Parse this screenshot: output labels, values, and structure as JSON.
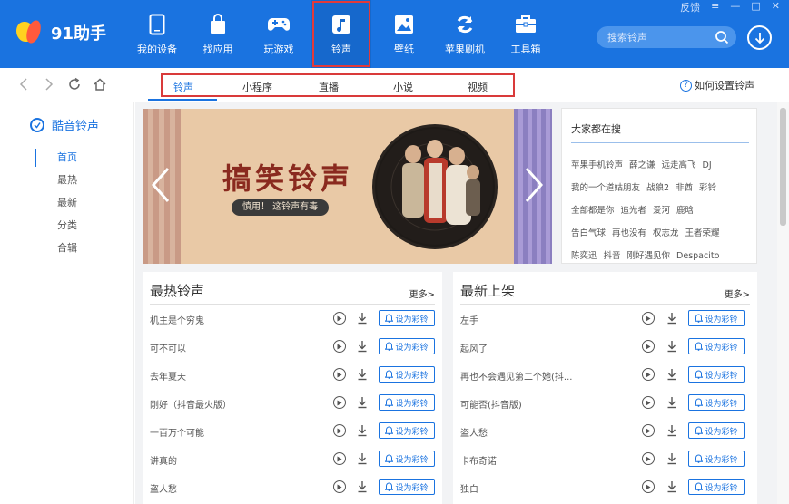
{
  "app": {
    "logo_text": "91助手"
  },
  "window": {
    "controls": [
      "反馈",
      "≡",
      "—",
      "□",
      "✕"
    ]
  },
  "nav": {
    "items": [
      {
        "label": "我的设备",
        "icon": "phone-icon"
      },
      {
        "label": "找应用",
        "icon": "bag-icon"
      },
      {
        "label": "玩游戏",
        "icon": "gamepad-icon"
      },
      {
        "label": "铃声",
        "icon": "music-note-icon",
        "active": true
      },
      {
        "label": "壁纸",
        "icon": "picture-icon"
      },
      {
        "label": "苹果刷机",
        "icon": "refresh-icon"
      },
      {
        "label": "工具箱",
        "icon": "toolbox-icon"
      }
    ]
  },
  "search": {
    "placeholder": "搜索铃声"
  },
  "tabs": [
    "铃声",
    "小程序",
    "直播",
    "小说",
    "视频"
  ],
  "howto": "如何设置铃声",
  "sidebar": {
    "title": "酷音铃声",
    "items": [
      "首页",
      "最热",
      "最新",
      "分类",
      "合辑"
    ]
  },
  "banner": {
    "title": "搞笑铃声",
    "subtitle": "慎用！ 这铃声有毒"
  },
  "hot_search": {
    "title": "大家都在搜",
    "rows": [
      [
        "苹果手机铃声",
        "薛之谦",
        "远走高飞",
        "DJ"
      ],
      [
        "我的一个道姑朋友",
        "战狼2",
        "非酋",
        "彩铃"
      ],
      [
        "全部都是你",
        "追光者",
        "爱河",
        "鹿晗"
      ],
      [
        "告白气球",
        "再也没有",
        "权志龙",
        "王者荣耀"
      ],
      [
        "陈奕迅",
        "抖音",
        "刚好遇见你",
        "Despacito"
      ]
    ]
  },
  "hot_list": {
    "title": "最热铃声",
    "more": "更多>",
    "songs": [
      "机主是个穷鬼",
      "可不可以",
      "去年夏天",
      "刚好（抖音最火版）",
      "一百万个可能",
      "讲真的",
      "盗人愁"
    ]
  },
  "new_list": {
    "title": "最新上架",
    "more": "更多>",
    "songs": [
      "左手",
      "起风了",
      "再也不会遇见第二个她(抖...",
      "可能否(抖音版)",
      "盗人愁",
      "卡布奇诺",
      "独白"
    ]
  },
  "button_label": "设为彩铃",
  "colors": {
    "brand": "#1a73e0",
    "highlight": "#d93a3a"
  }
}
